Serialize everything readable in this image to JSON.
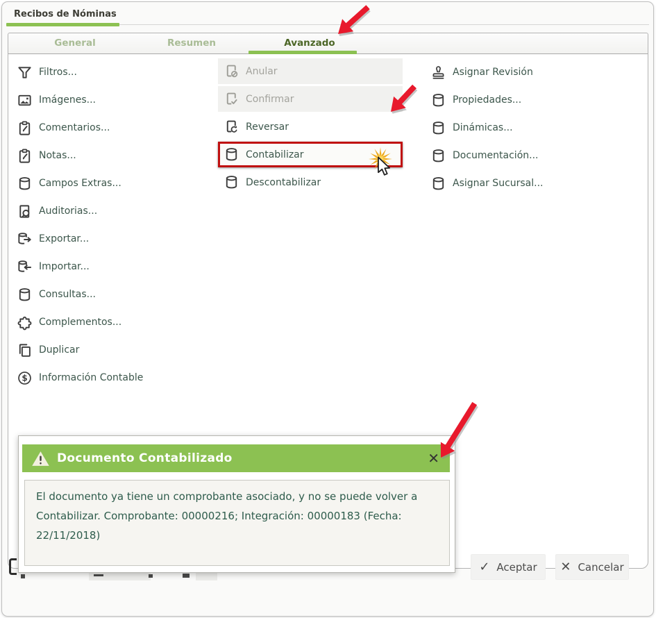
{
  "window": {
    "title": "Recibos de Nóminas"
  },
  "tabs": [
    {
      "label": "General",
      "active": false
    },
    {
      "label": "Resumen",
      "active": false
    },
    {
      "label": "Avanzado",
      "active": true
    }
  ],
  "menu": {
    "col1": [
      {
        "label": "Filtros...",
        "icon": "filter-icon"
      },
      {
        "label": "Imágenes...",
        "icon": "image-icon"
      },
      {
        "label": "Comentarios...",
        "icon": "clipboard-edit-icon"
      },
      {
        "label": "Notas...",
        "icon": "clipboard-edit-icon"
      },
      {
        "label": "Campos Extras...",
        "icon": "database-icon"
      },
      {
        "label": "Auditorias...",
        "icon": "document-search-icon"
      },
      {
        "label": "Exportar...",
        "icon": "database-export-icon"
      },
      {
        "label": "Importar...",
        "icon": "database-import-icon"
      },
      {
        "label": "Consultas...",
        "icon": "database-icon"
      },
      {
        "label": "Complementos...",
        "icon": "puzzle-icon"
      },
      {
        "label": "Duplicar",
        "icon": "duplicate-icon"
      },
      {
        "label": "Información Contable",
        "icon": "dollar-circle-icon"
      }
    ],
    "col2": [
      {
        "label": "Anular",
        "icon": "document-cancel-icon",
        "state": "disabled"
      },
      {
        "label": "Confirmar",
        "icon": "document-check-icon",
        "state": "disabled"
      },
      {
        "label": "Reversar",
        "icon": "document-refresh-icon",
        "state": "normal"
      },
      {
        "label": "Contabilizar",
        "icon": "database-icon",
        "state": "highlighted"
      },
      {
        "label": "Descontabilizar",
        "icon": "database-icon",
        "state": "normal"
      }
    ],
    "col3": [
      {
        "label": "Asignar Revisión",
        "icon": "stamp-icon"
      },
      {
        "label": "Propiedades...",
        "icon": "database-icon"
      },
      {
        "label": "Dinámicas...",
        "icon": "database-icon"
      },
      {
        "label": "Documentación...",
        "icon": "database-icon"
      },
      {
        "label": "Asignar Sucursal...",
        "icon": "database-icon"
      }
    ]
  },
  "popup": {
    "title": "Documento Contabilizado",
    "icon": "warning-icon",
    "close_glyph": "✕",
    "message": "El documento ya tiene un comprobante asociado, y no se puede volver a Contabilizar. Comprobante: 00000216; Integración: 00000183 (Fecha: 22/11/2018)"
  },
  "footer": {
    "accept_label": "Aceptar",
    "accept_icon_glyph": "✓",
    "cancel_label": "Cancelar",
    "cancel_icon_glyph": "✕"
  },
  "colors": {
    "accent_green": "#8cc152",
    "active_tab_text": "#4c6626",
    "inactive_tab_text": "#a9bc96",
    "menu_text": "#3c564b",
    "disabled_text": "#a3a39d",
    "popup_message_text": "#2e5c4c",
    "highlight_border_red": "#c01010",
    "annotation_arrow_red": "#e8192c",
    "click_burst_orange": "#eda71d"
  },
  "annotations": {
    "arrow_targets": [
      "tab-avanzado",
      "menu-item-contabilizar",
      "popup-close-button"
    ],
    "click_burst_on": "menu-item-contabilizar"
  }
}
